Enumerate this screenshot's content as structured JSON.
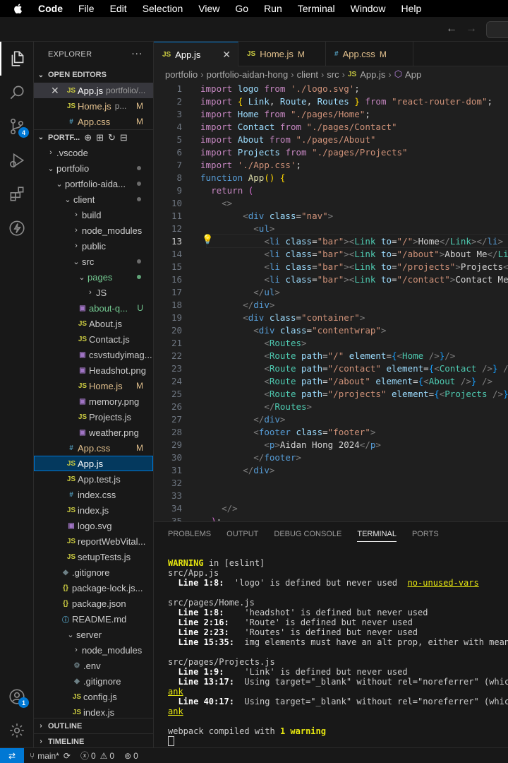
{
  "menubar": {
    "app": "Code",
    "items": [
      "File",
      "Edit",
      "Selection",
      "View",
      "Go",
      "Run",
      "Terminal",
      "Window",
      "Help"
    ]
  },
  "activity": {
    "scm_badge": "4",
    "accounts_badge": "1"
  },
  "sidebar": {
    "title": "EXPLORER",
    "open_editors_title": "OPEN EDITORS",
    "open_editors": [
      {
        "icon": "JS",
        "name": "App.js",
        "path": "portfolio/...",
        "deco": ""
      },
      {
        "icon": "JS",
        "name": "Home.js",
        "path": "p...",
        "deco": "M"
      },
      {
        "icon": "#",
        "name": "App.css",
        "path": "",
        "deco": "M"
      }
    ],
    "workspace_title": "PORTF...",
    "tree": [
      {
        "arrow": "›",
        "icon": "",
        "name": ".vscode",
        "deco": ""
      },
      {
        "arrow": "⌄",
        "icon": "",
        "name": "portfolio",
        "deco": "dot"
      },
      {
        "arrow": "⌄",
        "icon": "",
        "name": "portfolio-aida...",
        "deco": "dot"
      },
      {
        "arrow": "⌄",
        "icon": "",
        "name": "client",
        "deco": "dot"
      },
      {
        "arrow": "›",
        "icon": "",
        "name": "build",
        "deco": ""
      },
      {
        "arrow": "›",
        "icon": "",
        "name": "node_modules",
        "deco": ""
      },
      {
        "arrow": "›",
        "icon": "",
        "name": "public",
        "deco": ""
      },
      {
        "arrow": "⌄",
        "icon": "",
        "name": "src",
        "deco": "dot"
      },
      {
        "arrow": "⌄",
        "icon": "",
        "name": "pages",
        "deco": "dotg"
      },
      {
        "arrow": "›",
        "icon": "",
        "name": "JS",
        "deco": ""
      },
      {
        "arrow": "",
        "icon": "img",
        "name": "about-q...",
        "deco": "U"
      },
      {
        "arrow": "",
        "icon": "JS",
        "name": "About.js",
        "deco": ""
      },
      {
        "arrow": "",
        "icon": "JS",
        "name": "Contact.js",
        "deco": ""
      },
      {
        "arrow": "",
        "icon": "img",
        "name": "csvstudyimag...",
        "deco": ""
      },
      {
        "arrow": "",
        "icon": "img",
        "name": "Headshot.png",
        "deco": ""
      },
      {
        "arrow": "",
        "icon": "JS",
        "name": "Home.js",
        "deco": "M"
      },
      {
        "arrow": "",
        "icon": "img",
        "name": "memory.png",
        "deco": ""
      },
      {
        "arrow": "",
        "icon": "JS",
        "name": "Projects.js",
        "deco": ""
      },
      {
        "arrow": "",
        "icon": "img",
        "name": "weather.png",
        "deco": ""
      },
      {
        "arrow": "",
        "icon": "#",
        "name": "App.css",
        "deco": "M"
      },
      {
        "arrow": "",
        "icon": "JS",
        "name": "App.js",
        "deco": ""
      },
      {
        "arrow": "",
        "icon": "JS",
        "name": "App.test.js",
        "deco": ""
      },
      {
        "arrow": "",
        "icon": "#",
        "name": "index.css",
        "deco": ""
      },
      {
        "arrow": "",
        "icon": "JS",
        "name": "index.js",
        "deco": ""
      },
      {
        "arrow": "",
        "icon": "img",
        "name": "logo.svg",
        "deco": ""
      },
      {
        "arrow": "",
        "icon": "JS",
        "name": "reportWebVital...",
        "deco": ""
      },
      {
        "arrow": "",
        "icon": "JS",
        "name": "setupTests.js",
        "deco": ""
      },
      {
        "arrow": "",
        "icon": "git",
        "name": ".gitignore",
        "deco": ""
      },
      {
        "arrow": "",
        "icon": "{}",
        "name": "package-lock.js...",
        "deco": ""
      },
      {
        "arrow": "",
        "icon": "{}",
        "name": "package.json",
        "deco": ""
      },
      {
        "arrow": "",
        "icon": "md",
        "name": "README.md",
        "deco": ""
      },
      {
        "arrow": "⌄",
        "icon": "",
        "name": "server",
        "deco": ""
      },
      {
        "arrow": "›",
        "icon": "",
        "name": "node_modules",
        "deco": ""
      },
      {
        "arrow": "",
        "icon": "gear",
        "name": ".env",
        "deco": ""
      },
      {
        "arrow": "",
        "icon": "git",
        "name": ".gitignore",
        "deco": ""
      },
      {
        "arrow": "",
        "icon": "JS",
        "name": "config.js",
        "deco": ""
      },
      {
        "arrow": "",
        "icon": "JS",
        "name": "index.js",
        "deco": ""
      }
    ],
    "outline_title": "OUTLINE",
    "timeline_title": "TIMELINE"
  },
  "tabs": [
    {
      "icon": "JS",
      "name": "App.js",
      "mod": "",
      "active": true
    },
    {
      "icon": "JS",
      "name": "Home.js",
      "mod": "M",
      "active": false
    },
    {
      "icon": "#",
      "name": "App.css",
      "mod": "M",
      "active": false
    }
  ],
  "breadcrumbs": [
    "portfolio",
    "portfolio-aidan-hong",
    "client",
    "src",
    "App.js",
    "App"
  ],
  "editor": {
    "current_line": 13
  },
  "panel": {
    "tabs": [
      "PROBLEMS",
      "OUTPUT",
      "DEBUG CONSOLE",
      "TERMINAL",
      "PORTS"
    ],
    "active_tab": "TERMINAL",
    "terminal": {
      "warning_word": "WARNING",
      "warning_rest": " in [eslint]",
      "f1": "src/App.js",
      "l1_pos": "  Line 1:8:",
      "l1_msg": "  'logo' is defined but never used  ",
      "l1_rule": "no-unused-vars",
      "f2": "src/pages/Home.js",
      "l2_pos": "  Line 1:8:",
      "l2_msg": "    'headshot' is defined but never used",
      "l3_pos": "  Line 2:16:",
      "l3_msg": "   'Route' is defined but never used",
      "l4_pos": "  Line 2:23:",
      "l4_msg": "   'Routes' is defined but never used",
      "l5_pos": "  Line 15:35:",
      "l5_msg": "  img elements must have an alt prop, either with meanin",
      "f3": "src/pages/Projects.js",
      "l6_pos": "  Line 1:9:",
      "l6_msg": "    'Link' is defined but never used",
      "l7_pos": "  Line 13:17:",
      "l7_msg": "  Using target=\"_blank\" without rel=\"noreferrer\" (which",
      "l7_cont": "ank",
      "l8_pos": "  Line 40:17:",
      "l8_msg": "  Using target=\"_blank\" without rel=\"noreferrer\" (which",
      "l8_cont": "ank",
      "compiled_pre": "webpack compiled with ",
      "compiled_count": "1 warning"
    }
  },
  "status": {
    "branch": "main*",
    "errors": "0",
    "warnings": "0",
    "ports": "0"
  }
}
